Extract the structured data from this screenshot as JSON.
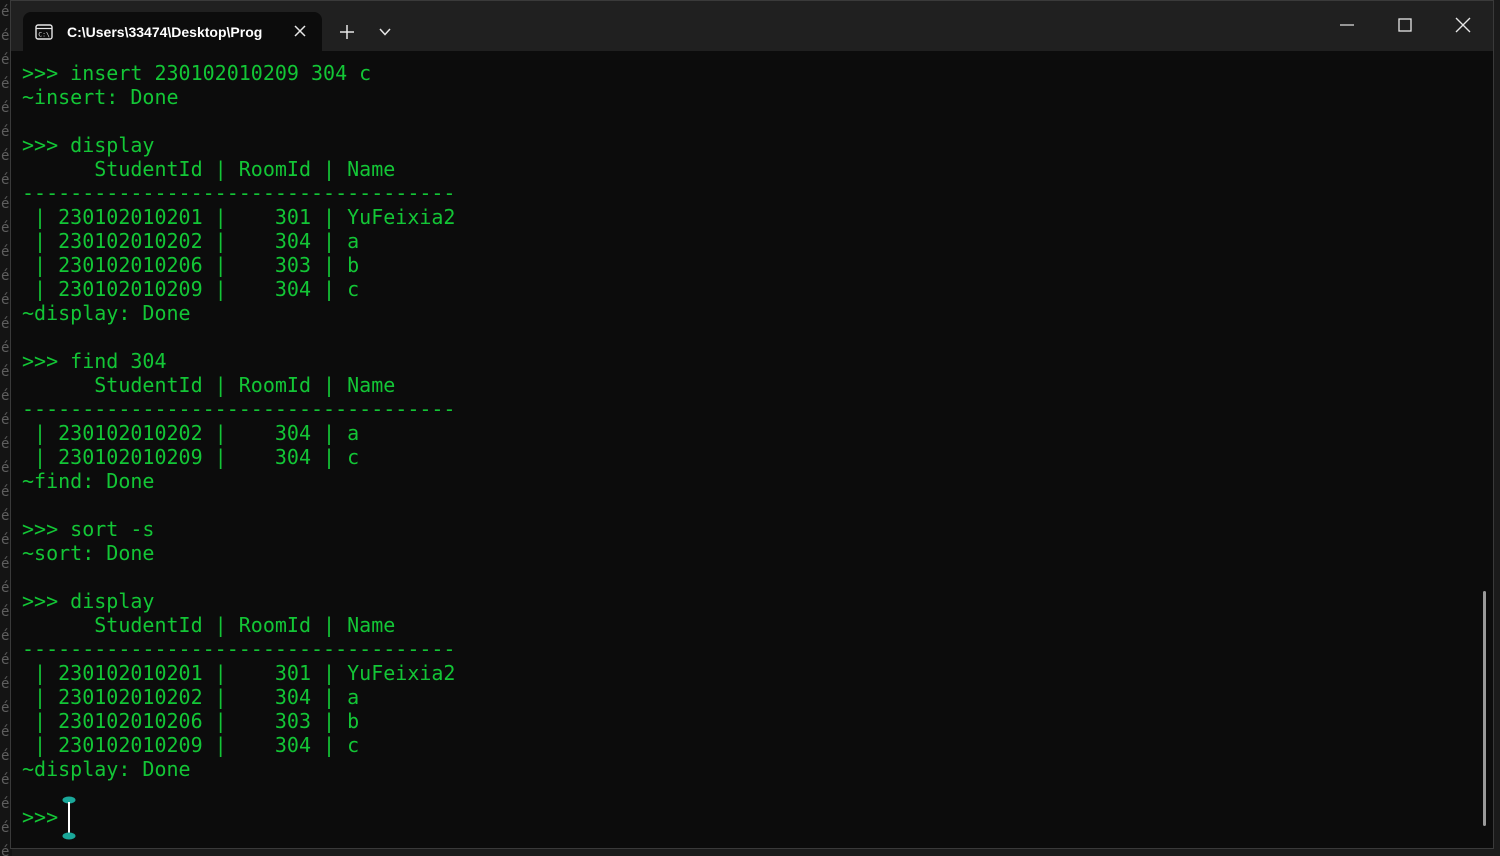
{
  "window": {
    "tab_title": "C:\\Users\\33474\\Desktop\\Prog",
    "icons": [
      "terminal-icon",
      "close-icon",
      "plus-icon",
      "chevron-down-icon",
      "minimize-icon",
      "maximize-icon",
      "close-window-icon"
    ]
  },
  "left_strip_glyph": "é",
  "terminal": {
    "lines": [
      ">>> insert 230102010209 304 c",
      "~insert: Done",
      "",
      ">>> display",
      "      StudentId | RoomId | Name",
      "------------------------------------",
      " | 230102010201 |    301 | YuFeixia2",
      " | 230102010202 |    304 | a",
      " | 230102010206 |    303 | b",
      " | 230102010209 |    304 | c",
      "~display: Done",
      "",
      ">>> find 304",
      "      StudentId | RoomId | Name",
      "------------------------------------",
      " | 230102010202 |    304 | a",
      " | 230102010209 |    304 | c",
      "~find: Done",
      "",
      ">>> sort -s",
      "~sort: Done",
      "",
      ">>> display",
      "      StudentId | RoomId | Name",
      "------------------------------------",
      " | 230102010201 |    301 | YuFeixia2",
      " | 230102010202 |    304 | a",
      " | 230102010206 |    303 | b",
      " | 230102010209 |    304 | c",
      "~display: Done",
      "",
      ">>>"
    ]
  },
  "colors": {
    "terminal_text": "#13c636",
    "terminal_bg": "#0c0c0c",
    "titlebar_bg": "#202020"
  }
}
